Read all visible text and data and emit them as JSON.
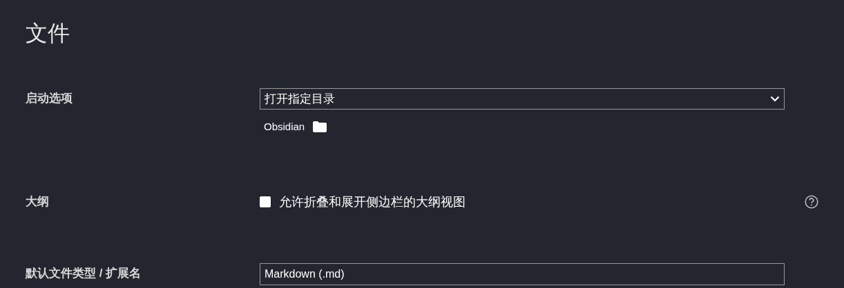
{
  "heading": "文件",
  "settings": [
    {
      "kind": "select",
      "label": "启动选项",
      "value": "打开指定目录",
      "folder": "Obsidian"
    },
    {
      "kind": "checkbox",
      "label": "大纲",
      "text": "允许折叠和展开侧边栏的大纲视图",
      "checked": false
    },
    {
      "kind": "text",
      "label": "默认文件类型 / 扩展名",
      "value": "Markdown (.md)"
    }
  ]
}
